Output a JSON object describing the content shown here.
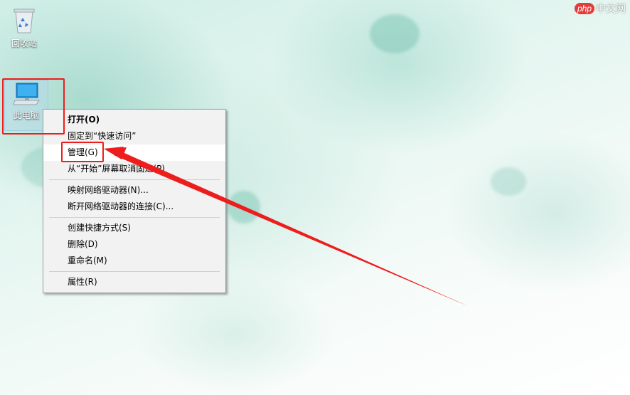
{
  "desktop": {
    "icons": [
      {
        "label": "回收站",
        "icon": "recycle-bin-icon"
      },
      {
        "label": "此电脑",
        "icon": "computer-monitor-icon"
      }
    ]
  },
  "context_menu": {
    "items": [
      {
        "label": "打开(O)"
      },
      {
        "label": "固定到“快速访问”"
      },
      {
        "label": "管理(G)"
      },
      {
        "label": "从“开始”屏幕取消固定(P)"
      },
      {
        "label": "映射网络驱动器(N)..."
      },
      {
        "label": "断开网络驱动器的连接(C)..."
      },
      {
        "label": "创建快捷方式(S)"
      },
      {
        "label": "删除(D)"
      },
      {
        "label": "重命名(M)"
      },
      {
        "label": "属性(R)"
      }
    ]
  },
  "watermark": {
    "badge": "php",
    "text": "中文网"
  },
  "colors": {
    "annotation": "#ee1d1d",
    "menu_background": "#f2f2f2",
    "menu_hover": "#ffffff"
  }
}
